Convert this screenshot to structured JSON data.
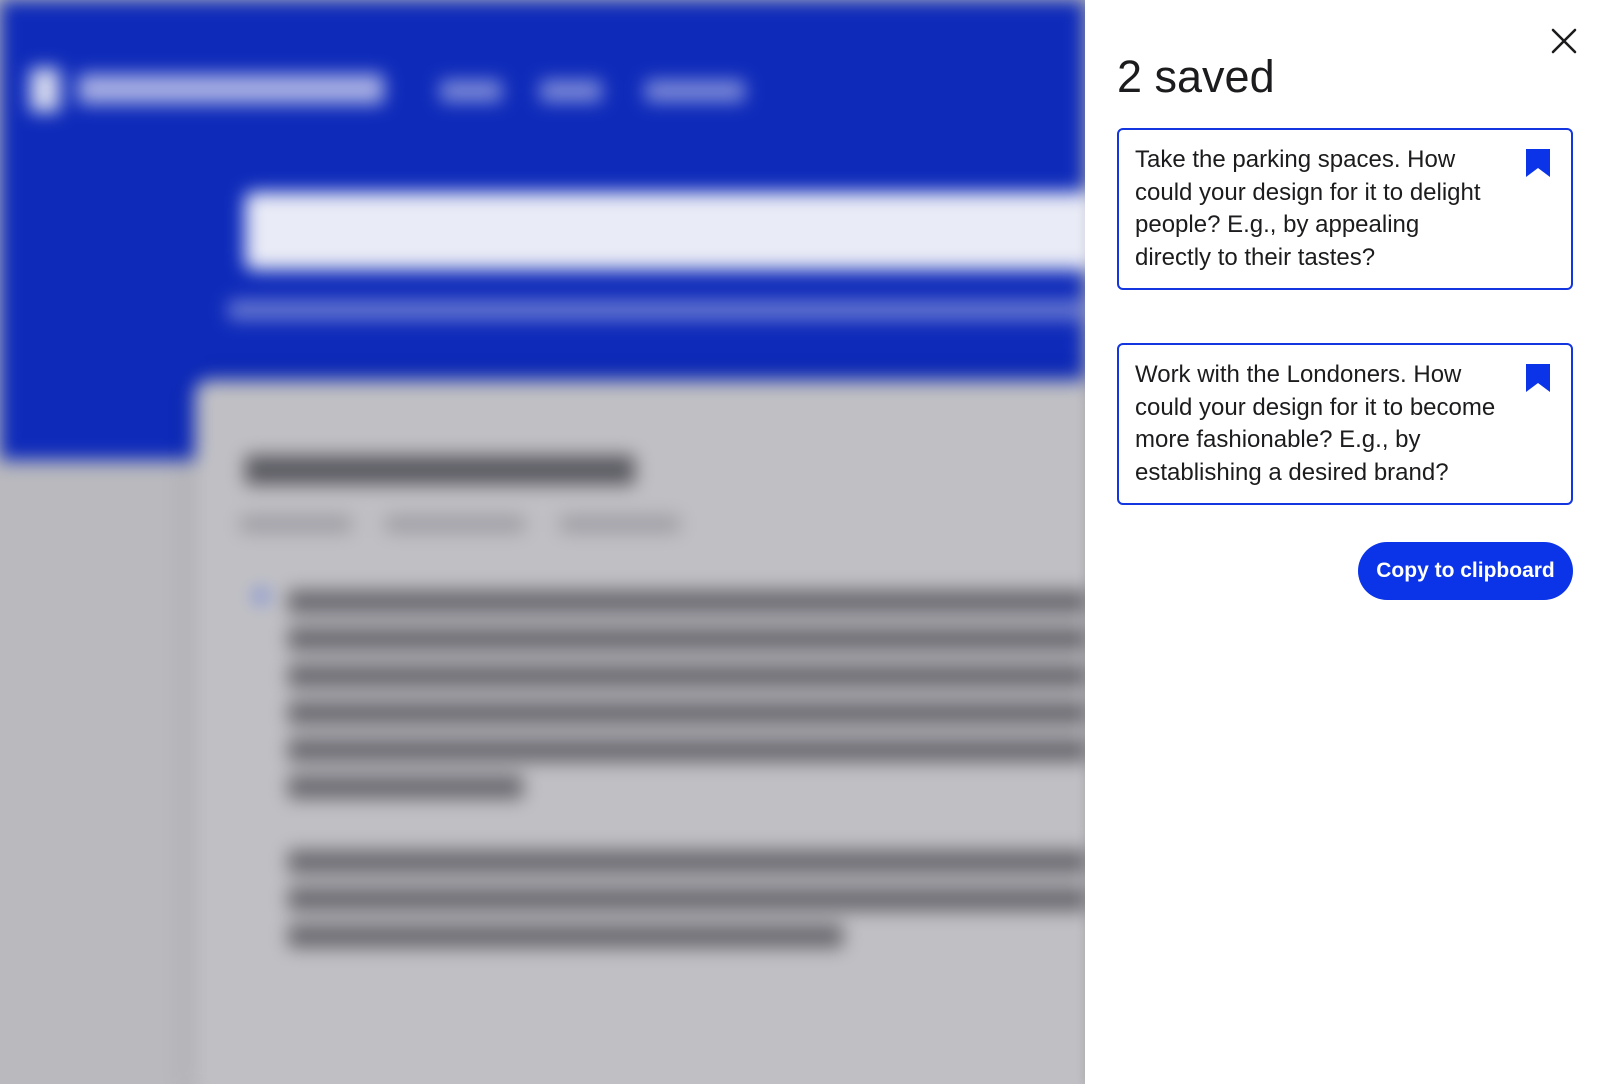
{
  "drawer": {
    "title": "2 saved",
    "close_icon": "close-icon",
    "items": [
      {
        "text": "Take the parking spaces. How could your design for it to delight people? E.g., by appealing directly to their tastes?",
        "icon": "bookmark-filled-icon"
      },
      {
        "text": "Work with the Londoners. How could your design for it to become more fashionable? E.g., by establishing a desired brand?",
        "icon": "bookmark-filled-icon"
      }
    ],
    "copy_label": "Copy to clipboard"
  },
  "colors": {
    "accent": "#0b34e8",
    "card_border": "#1336e0",
    "background_brand": "#0e2bbd",
    "text": "#1c1c1e"
  }
}
